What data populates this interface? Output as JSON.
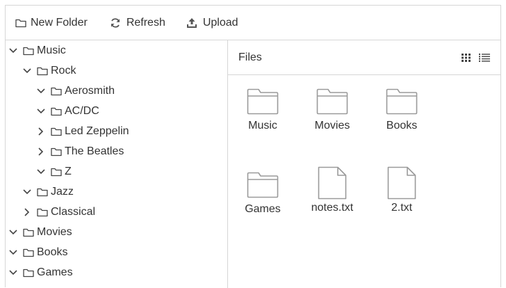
{
  "toolbar": {
    "new_folder_label": "New Folder",
    "refresh_label": "Refresh",
    "upload_label": "Upload"
  },
  "tree": [
    {
      "label": "Music",
      "depth": 0,
      "state": "expanded"
    },
    {
      "label": "Rock",
      "depth": 1,
      "state": "expanded"
    },
    {
      "label": "Aerosmith",
      "depth": 2,
      "state": "expanded"
    },
    {
      "label": "AC/DC",
      "depth": 2,
      "state": "expanded"
    },
    {
      "label": "Led Zeppelin",
      "depth": 2,
      "state": "collapsed"
    },
    {
      "label": "The Beatles",
      "depth": 2,
      "state": "collapsed"
    },
    {
      "label": "Z",
      "depth": 2,
      "state": "expanded"
    },
    {
      "label": "Jazz",
      "depth": 1,
      "state": "expanded"
    },
    {
      "label": "Classical",
      "depth": 1,
      "state": "collapsed"
    },
    {
      "label": "Movies",
      "depth": 0,
      "state": "expanded"
    },
    {
      "label": "Books",
      "depth": 0,
      "state": "expanded"
    },
    {
      "label": "Games",
      "depth": 0,
      "state": "expanded"
    }
  ],
  "pane": {
    "title": "Files",
    "view_modes": [
      "grid-view-icon",
      "list-view-icon"
    ],
    "items": [
      {
        "label": "Music",
        "kind": "folder"
      },
      {
        "label": "Movies",
        "kind": "folder"
      },
      {
        "label": "Books",
        "kind": "folder"
      },
      {
        "label": "Games",
        "kind": "folder"
      },
      {
        "label": "notes.txt",
        "kind": "file"
      },
      {
        "label": "2.txt",
        "kind": "file"
      }
    ]
  },
  "colors": {
    "border": "#d6d6d6",
    "text": "#333333",
    "icon": "#9a9a9a"
  }
}
